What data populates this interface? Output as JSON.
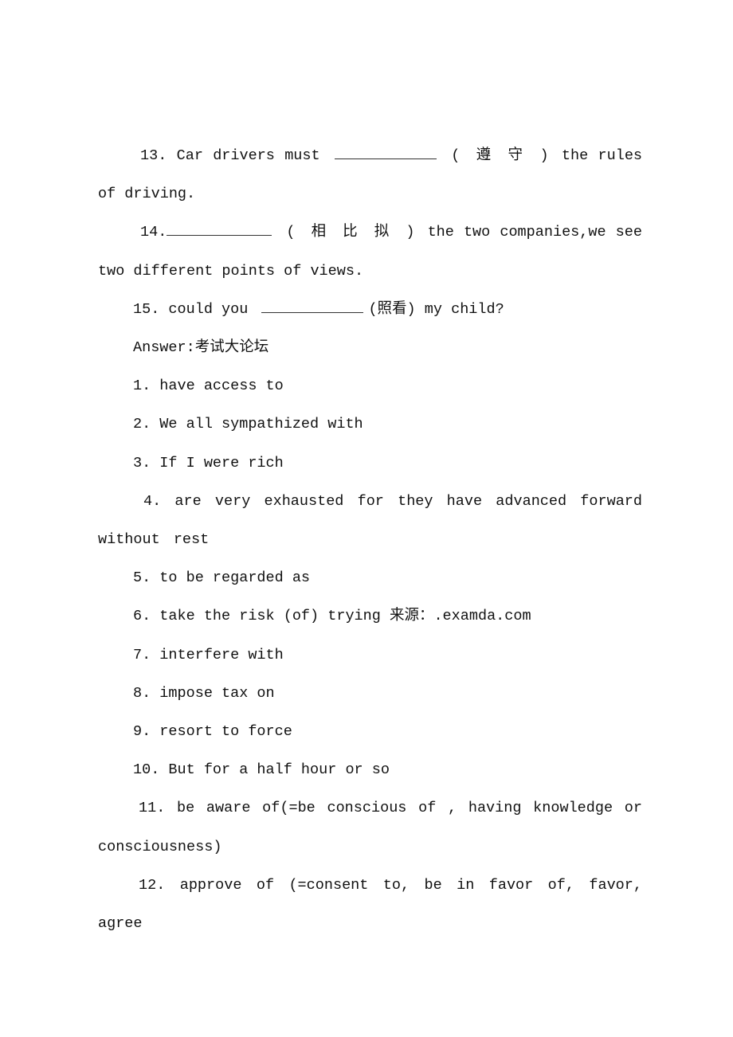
{
  "questions": [
    {
      "number": "13.",
      "before": "Car drivers must",
      "hint": "( 遵 守 )",
      "after": "the rules of driving."
    },
    {
      "number": "14.",
      "before": "",
      "hint": "( 相 比 拟 )",
      "after": "the two companies,we see two different points of views."
    },
    {
      "number": "15.",
      "before": "could you",
      "hint": "(照看)",
      "after": "my child?"
    }
  ],
  "answer_heading": "Answer:考试大论坛",
  "answers": [
    "1. have access to",
    "2. We all sympathized with",
    "3. If I were rich",
    "4.  are very exhausted for they have advanced forward without rest",
    "5. to be regarded as",
    "6. take the risk (of) trying 来源：.examda.com",
    "7. interfere with",
    "8. impose tax on",
    "9. resort to force",
    "10. But for a half hour or so",
    "11.  be aware of(=be conscious of , having knowledge or consciousness)",
    "12. approve of (=consent to, be in favor of, favor, agree"
  ]
}
